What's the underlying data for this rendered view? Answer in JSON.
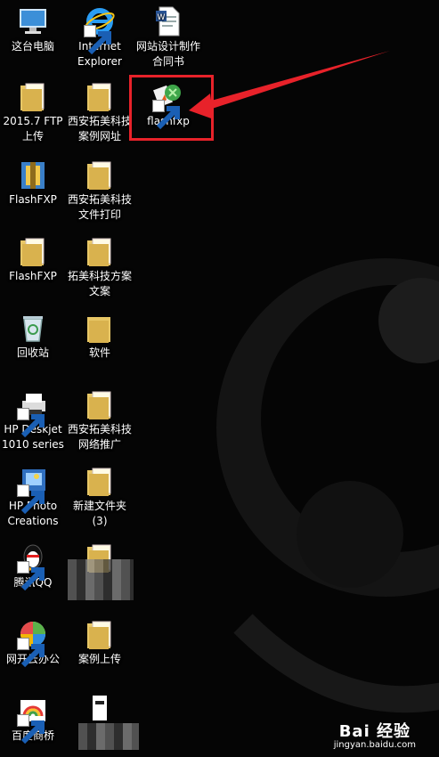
{
  "icons": {
    "this_pc": "这台电脑",
    "internet_explorer": "Internet\nExplorer",
    "contract_doc": "网站设计制作\n合同书",
    "ftp_folder": "2015.7  FTP\n上传",
    "case_url_folder": "西安拓美科技\n案例网址",
    "flashfxp_highlight": "flashfxp",
    "flashfxp_archive": "FlashFXP",
    "print_folder": "西安拓美科技\n文件打印",
    "flashfxp_folder": "FlashFXP",
    "proposal_folder": "拓美科技方案\n文案",
    "recycle_bin": "回收站",
    "software_folder": "软件",
    "hp_deskjet": "HP Deskjet\n1010 series",
    "network_promo_folder": "西安拓美科技\n网络推广",
    "hp_photo": "HP Photo\nCreations",
    "new_folder_3": "新建文件夹\n(3)",
    "tencent_qq": "腾讯QQ",
    "wangkai_cloud": "网开云办公",
    "case_upload_folder": "案例上传",
    "baidu_shangqiao": "百度商桥"
  },
  "watermark": {
    "brand": "Bai  经验",
    "url": "jingyan.baidu.com"
  },
  "colors": {
    "highlight": "#e8222a",
    "folder": "#e8c766",
    "background": "#050505"
  }
}
